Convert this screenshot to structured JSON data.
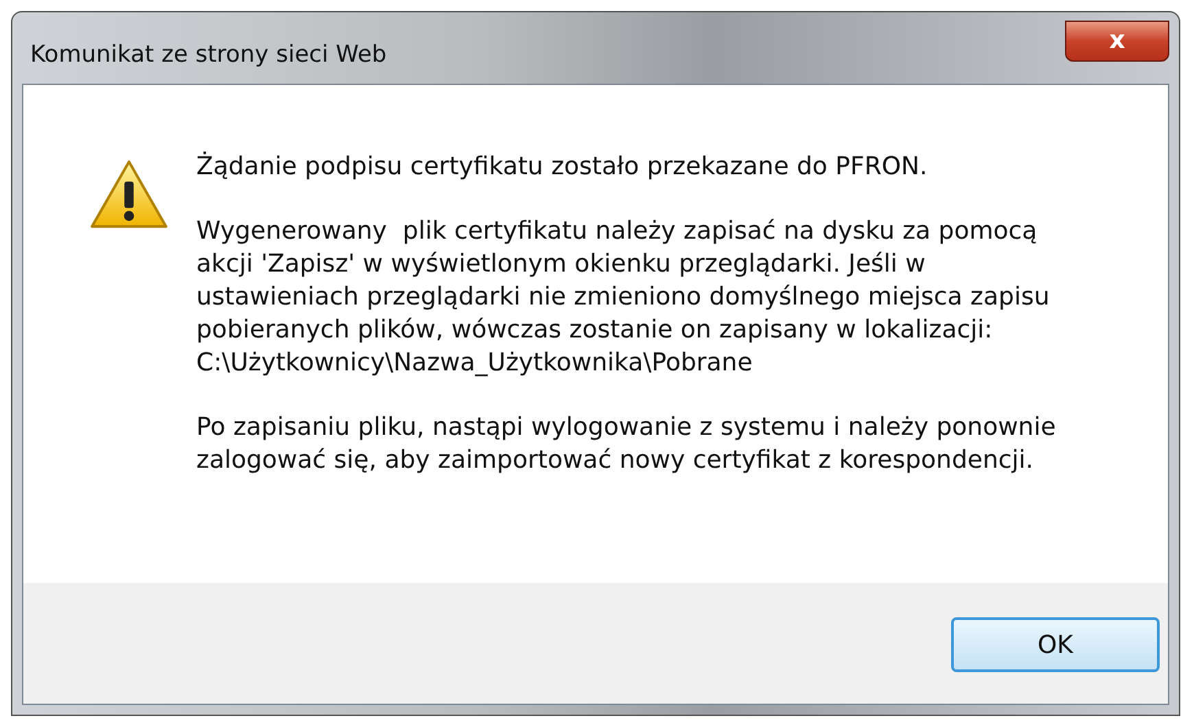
{
  "window": {
    "title": "Komunikat ze strony sieci Web",
    "close": "x"
  },
  "message": {
    "kind": "warning",
    "paragraphs": [
      "Żądanie podpisu certyfikatu zostało przekazane do PFRON.",
      "Wygenerowany  plik certyfikatu należy zapisać na dysku za pomocą\nakcji 'Zapisz' w wyświetlonym okienku przeglądarki. Jeśli w\nustawieniach przeglądarki nie zmieniono domyślnego miejsca zapisu\npobieranych plików, wówczas zostanie on zapisany w lokalizacji:\nC:\\Użytkownicy\\Nazwa_Użytkownika\\Pobrane",
      "Po zapisaniu pliku, nastąpi wylogowanie z systemu i należy ponownie\nzalogować się, aby zaimportować nowy certyfikat z korespondencji."
    ]
  },
  "buttons": [
    {
      "label": "OK",
      "selected": true
    }
  ]
}
